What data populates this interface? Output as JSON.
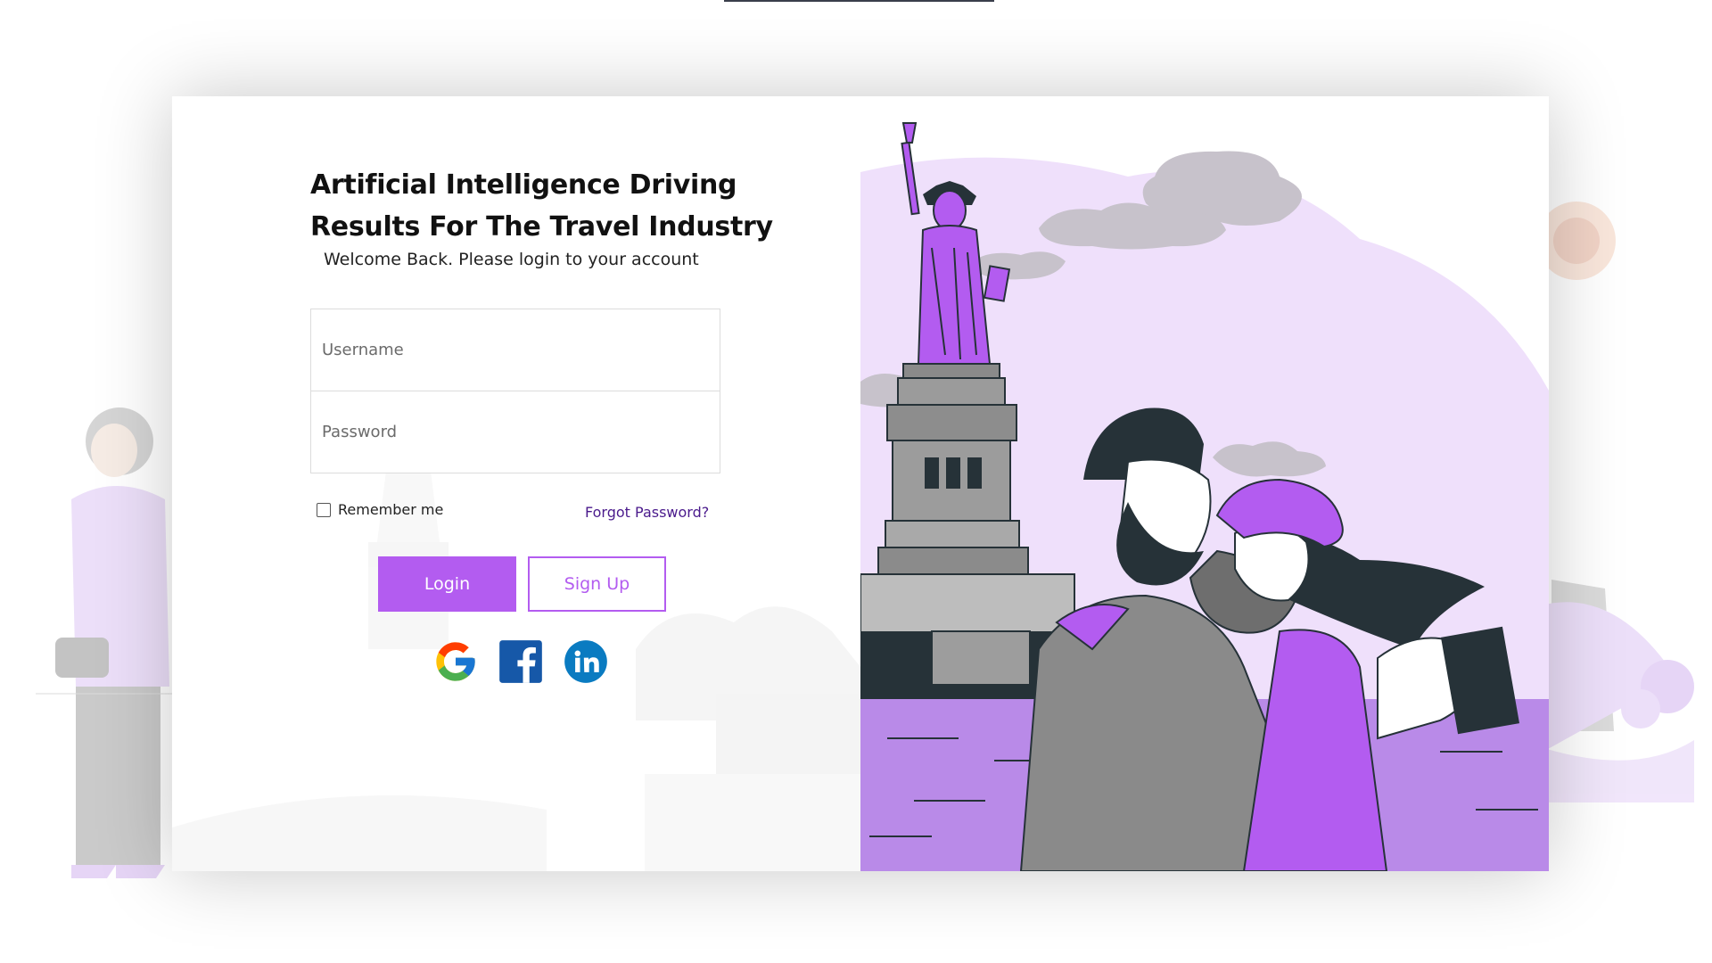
{
  "login": {
    "title": "Artificial Intelligence Driving Results For The Travel Industry",
    "subtitle": "Welcome Back. Please login to your account",
    "username_placeholder": "Username",
    "password_placeholder": "Password",
    "remember_label": "Remember me",
    "forgot_label": "Forgot Password?",
    "login_label": "Login",
    "signup_label": "Sign Up"
  },
  "social": {
    "icons": [
      "google-icon",
      "facebook-icon",
      "linkedin-icon"
    ]
  },
  "colors": {
    "accent": "#b35cf0",
    "accent_light": "#efe0fb",
    "forgot_link": "#4a1a8c",
    "dark": "#263238"
  },
  "illustration": {
    "subject": "statue-of-liberty-travel-couple"
  }
}
